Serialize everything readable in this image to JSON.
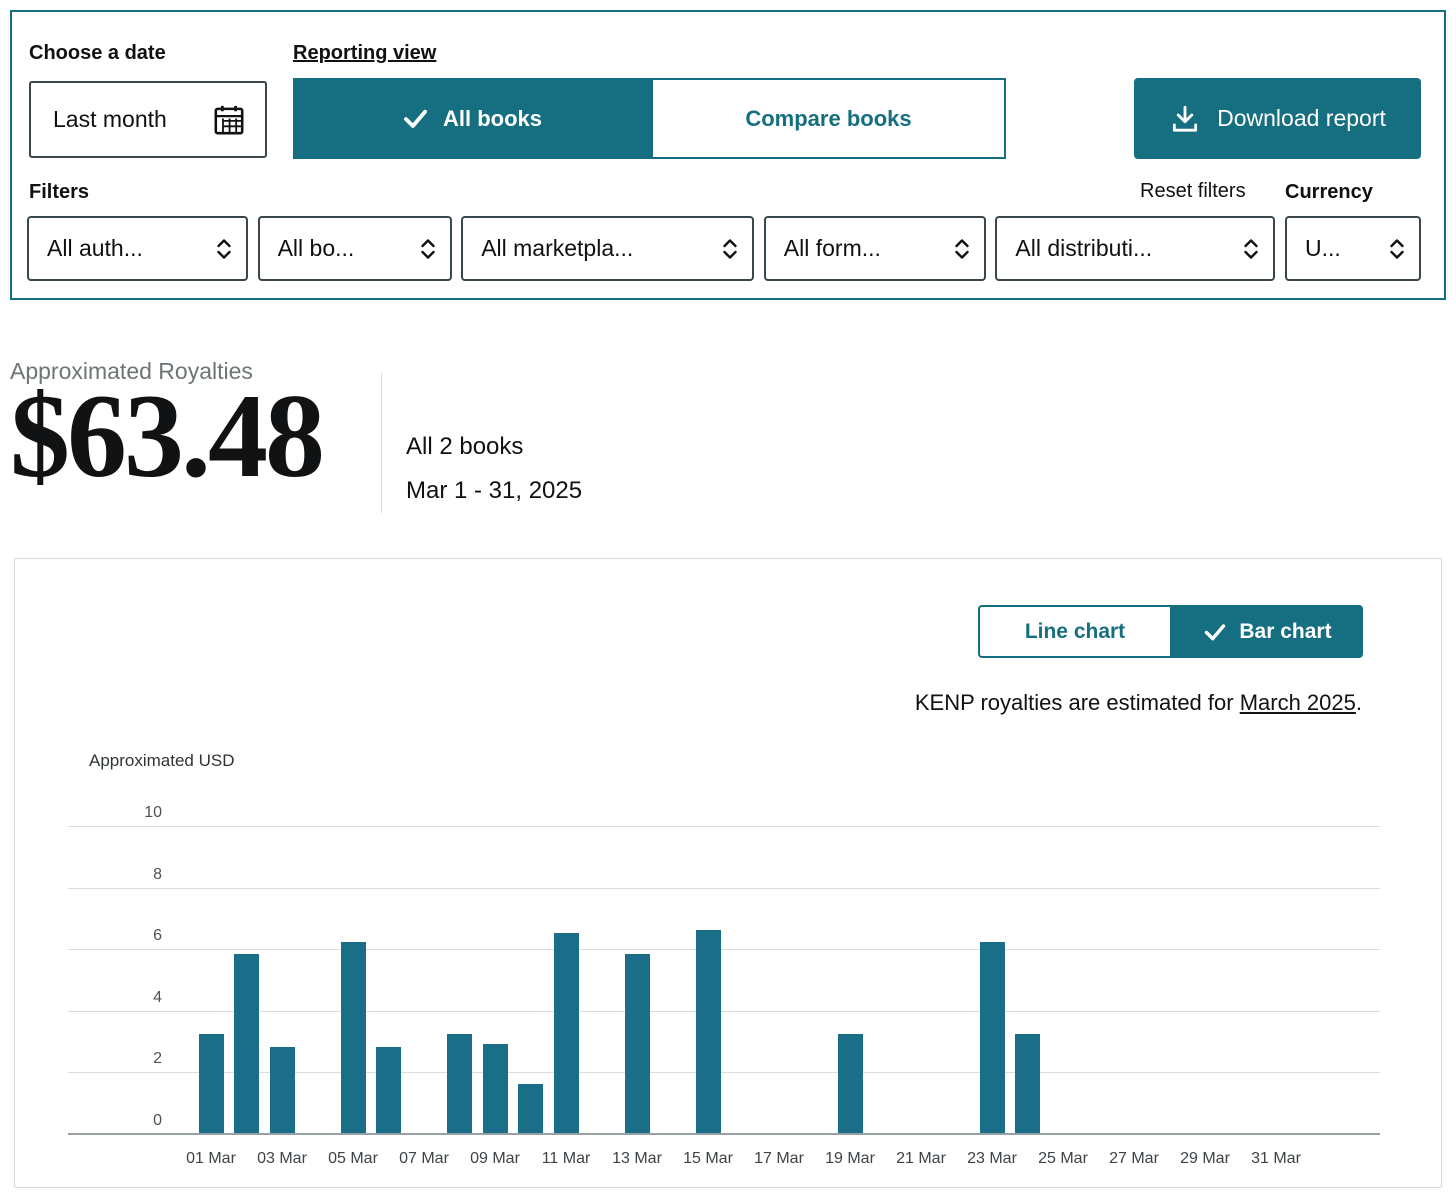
{
  "colors": {
    "accent": "#156f80",
    "bar": "#1a6e87"
  },
  "top_panel": {
    "choose_date_label": "Choose a date",
    "date_button": "Last month",
    "reporting_view_label": "Reporting view",
    "all_books_label": "All books",
    "compare_books_label": "Compare books",
    "download_report_label": "Download report",
    "filters_label": "Filters",
    "reset_filters_label": "Reset filters",
    "currency_label": "Currency",
    "filters": [
      "All auth...",
      "All bo...",
      "All marketpla...",
      "All form...",
      "All distributi...",
      "U..."
    ]
  },
  "summary": {
    "label": "Approximated Royalties",
    "amount": "$63.48",
    "books": "All 2 books",
    "period": "Mar 1 - 31, 2025"
  },
  "chart_panel": {
    "line_chart_label": "Line chart",
    "bar_chart_label": "Bar chart",
    "kenp_prefix": "KENP royalties are estimated for ",
    "kenp_link": "March 2025",
    "kenp_suffix": "."
  },
  "chart_data": {
    "type": "bar",
    "title": "KENP royalties are estimated for March 2025.",
    "ylabel": "Approximated USD",
    "xlabel": "",
    "ylim": [
      0,
      10
    ],
    "yticks": [
      0,
      2,
      4,
      6,
      8,
      10
    ],
    "grid": "horizontal",
    "legend": "none",
    "categories": [
      "01 Mar",
      "02 Mar",
      "03 Mar",
      "04 Mar",
      "05 Mar",
      "06 Mar",
      "07 Mar",
      "08 Mar",
      "09 Mar",
      "10 Mar",
      "11 Mar",
      "12 Mar",
      "13 Mar",
      "14 Mar",
      "15 Mar",
      "16 Mar",
      "17 Mar",
      "18 Mar",
      "19 Mar",
      "20 Mar",
      "21 Mar",
      "22 Mar",
      "23 Mar",
      "24 Mar",
      "25 Mar",
      "26 Mar",
      "27 Mar",
      "28 Mar",
      "29 Mar",
      "30 Mar",
      "31 Mar"
    ],
    "values": [
      3.2,
      5.8,
      2.8,
      0,
      6.2,
      2.8,
      0,
      3.2,
      2.9,
      1.6,
      6.5,
      0,
      5.8,
      0,
      6.6,
      0,
      0,
      0,
      3.2,
      0,
      0,
      0,
      6.2,
      3.2,
      0,
      0,
      0,
      0,
      0,
      0,
      0
    ],
    "xtick_labels": [
      "01 Mar",
      "03 Mar",
      "05 Mar",
      "07 Mar",
      "09 Mar",
      "11 Mar",
      "13 Mar",
      "15 Mar",
      "17 Mar",
      "19 Mar",
      "21 Mar",
      "23 Mar",
      "25 Mar",
      "27 Mar",
      "29 Mar",
      "31 Mar"
    ]
  }
}
